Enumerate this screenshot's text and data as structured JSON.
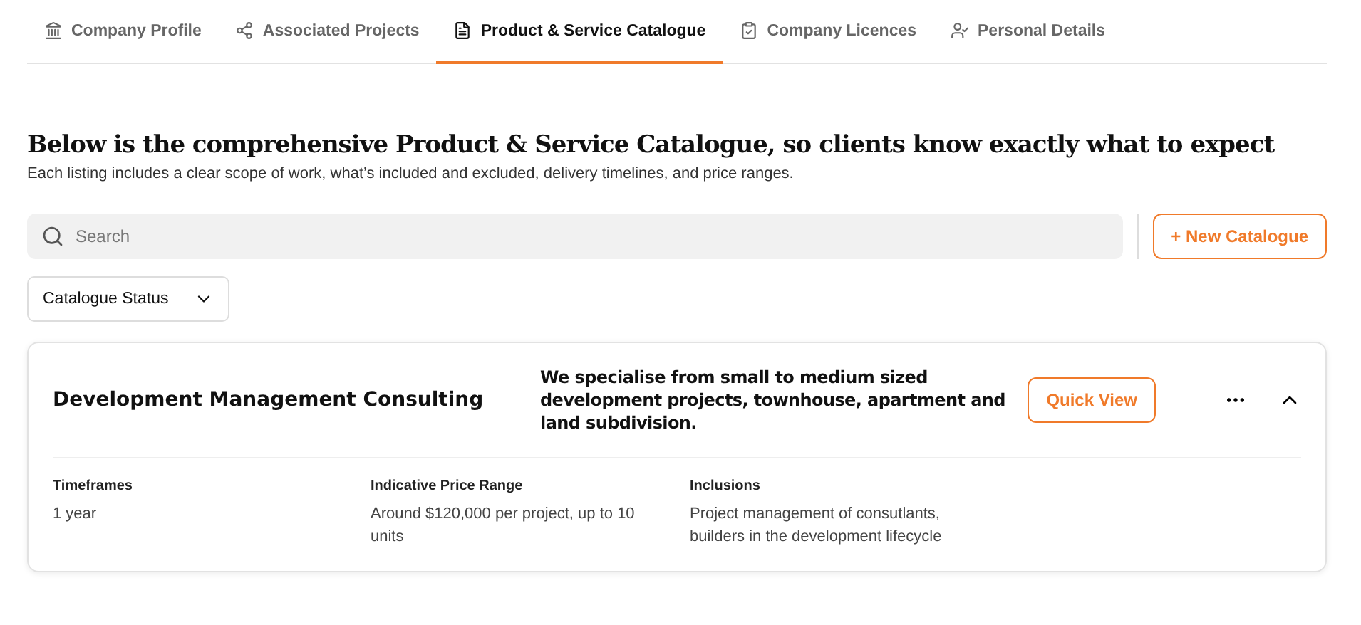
{
  "tabs": [
    {
      "label": "Company Profile",
      "selected": false
    },
    {
      "label": "Associated Projects",
      "selected": false
    },
    {
      "label": "Product & Service Catalogue",
      "selected": true
    },
    {
      "label": "Company Licences",
      "selected": false
    },
    {
      "label": "Personal Details",
      "selected": false
    }
  ],
  "heading": "Below is the comprehensive Product & Service Catalogue, so clients know exactly what to expect",
  "subheading": "Each listing includes a clear scope of work, what’s included and excluded, delivery timelines, and price ranges.",
  "search": {
    "placeholder": "Search"
  },
  "new_button": "+ New Catalogue",
  "status_filter": "Catalogue Status",
  "catalogues": [
    {
      "title": "Development Management Consulting",
      "summary": "We specialise from small to medium sized development projects, townhouse, apartment and land subdivision.",
      "action": "Quick View",
      "expanded": true,
      "details": [
        {
          "label": "Timeframes",
          "value": "1 year"
        },
        {
          "label": "Indicative Price Range",
          "value": "Around $120,000 per project, up to 10 units"
        },
        {
          "label": "Inclusions",
          "value": "Project management of consutlants, builders in the development lifecycle"
        }
      ]
    }
  ]
}
